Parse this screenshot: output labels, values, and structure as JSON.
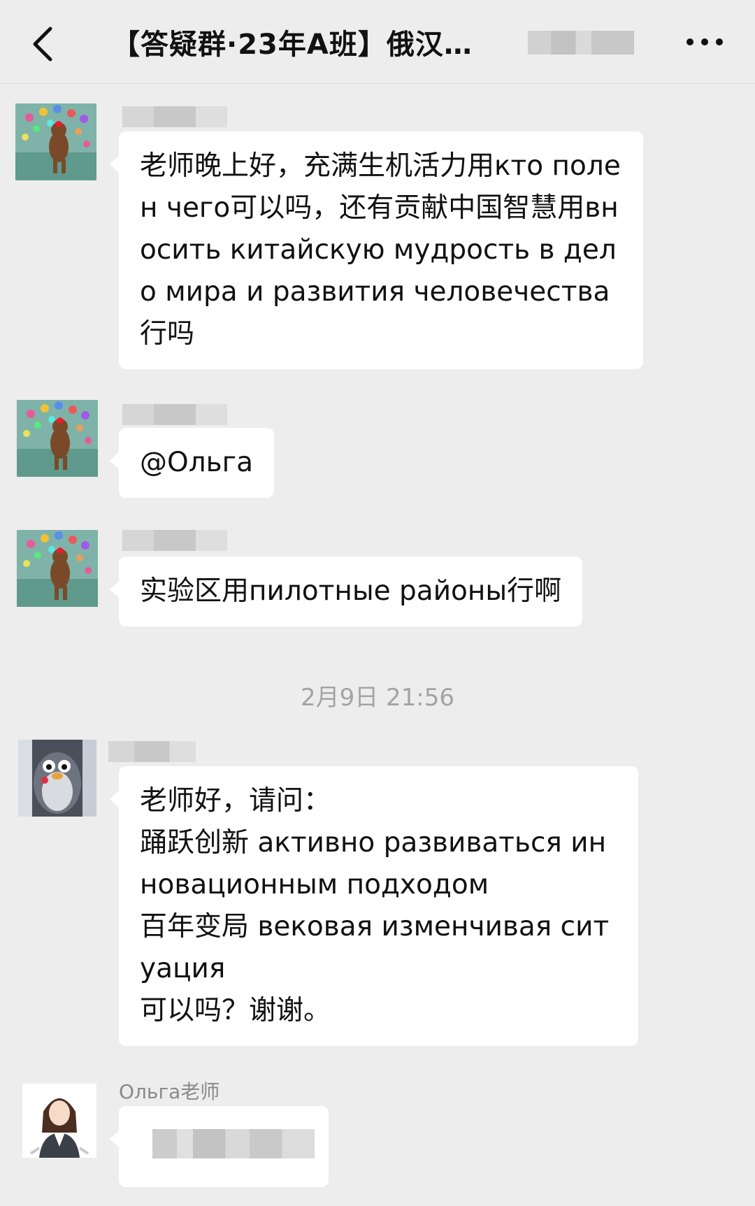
{
  "header": {
    "title": "【答疑群·23年A班】俄汉…"
  },
  "messages": [
    {
      "text": "老师晚上好，充满生机活力用кто полен чего可以吗，还有贡献中国智慧用вносить китайскую мудрость в дело мира и развития человечества行吗"
    },
    {
      "text": "@Ольга"
    },
    {
      "text": "实验区用пилотные районы行啊"
    },
    {
      "timestamp": "2月9日 21:56"
    },
    {
      "text": "老师好，请问：\n踊跃创新 активно развиваться инновационным подходом\n百年变局 вековая изменчивая ситуация\n可以吗？谢谢。"
    },
    {
      "sender": "Ольга老师"
    }
  ],
  "icons": {
    "back": "back-chevron-icon",
    "more": "more-dots-icon"
  },
  "colors": {
    "background": "#ededed",
    "bubble": "#ffffff",
    "timestamp": "#a3a3a3"
  }
}
